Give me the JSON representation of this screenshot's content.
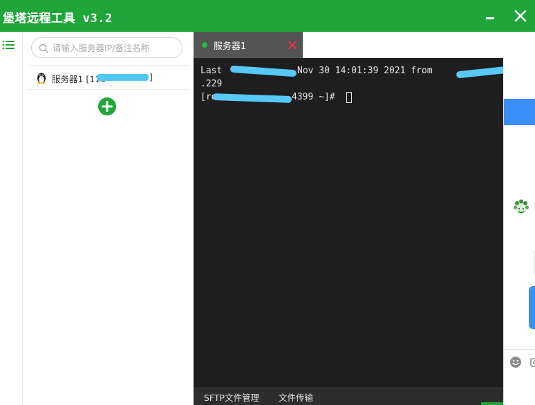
{
  "window": {
    "title": "堡塔远程工具 v3.2",
    "minimize_icon": "minimize-icon",
    "close_icon": "close-icon",
    "accent_color": "#20a53a"
  },
  "sidebar": {
    "menu_icon": "list-menu-icon"
  },
  "server_list": {
    "search": {
      "placeholder": "请输入服务器IP/备注名称",
      "value": ""
    },
    "servers": [
      {
        "name_prefix": "服务器1 [110",
        "name_suffix": "]",
        "icon": "linux-penguin-icon"
      }
    ],
    "add_icon": "plus-icon"
  },
  "tabs": [
    {
      "label": "服务器1",
      "status_color": "#2bb845",
      "close_icon": "close-icon"
    }
  ],
  "terminal": {
    "lines": [
      {
        "a": "Last ",
        "b": "Nov 30 14:01:39 2021 from ",
        "c": ""
      },
      {
        "a": ".229"
      },
      {
        "a": "[ro",
        "b": "4399 ~]# "
      }
    ]
  },
  "bottom_bar": {
    "sftp_label": "SFTP文件管理",
    "transfer_label": "文件传输"
  },
  "chat_widget": {
    "header_color": "#3a8ef6",
    "emoji_icon": "emoji-icon",
    "camera_icon": "camera-icon"
  }
}
